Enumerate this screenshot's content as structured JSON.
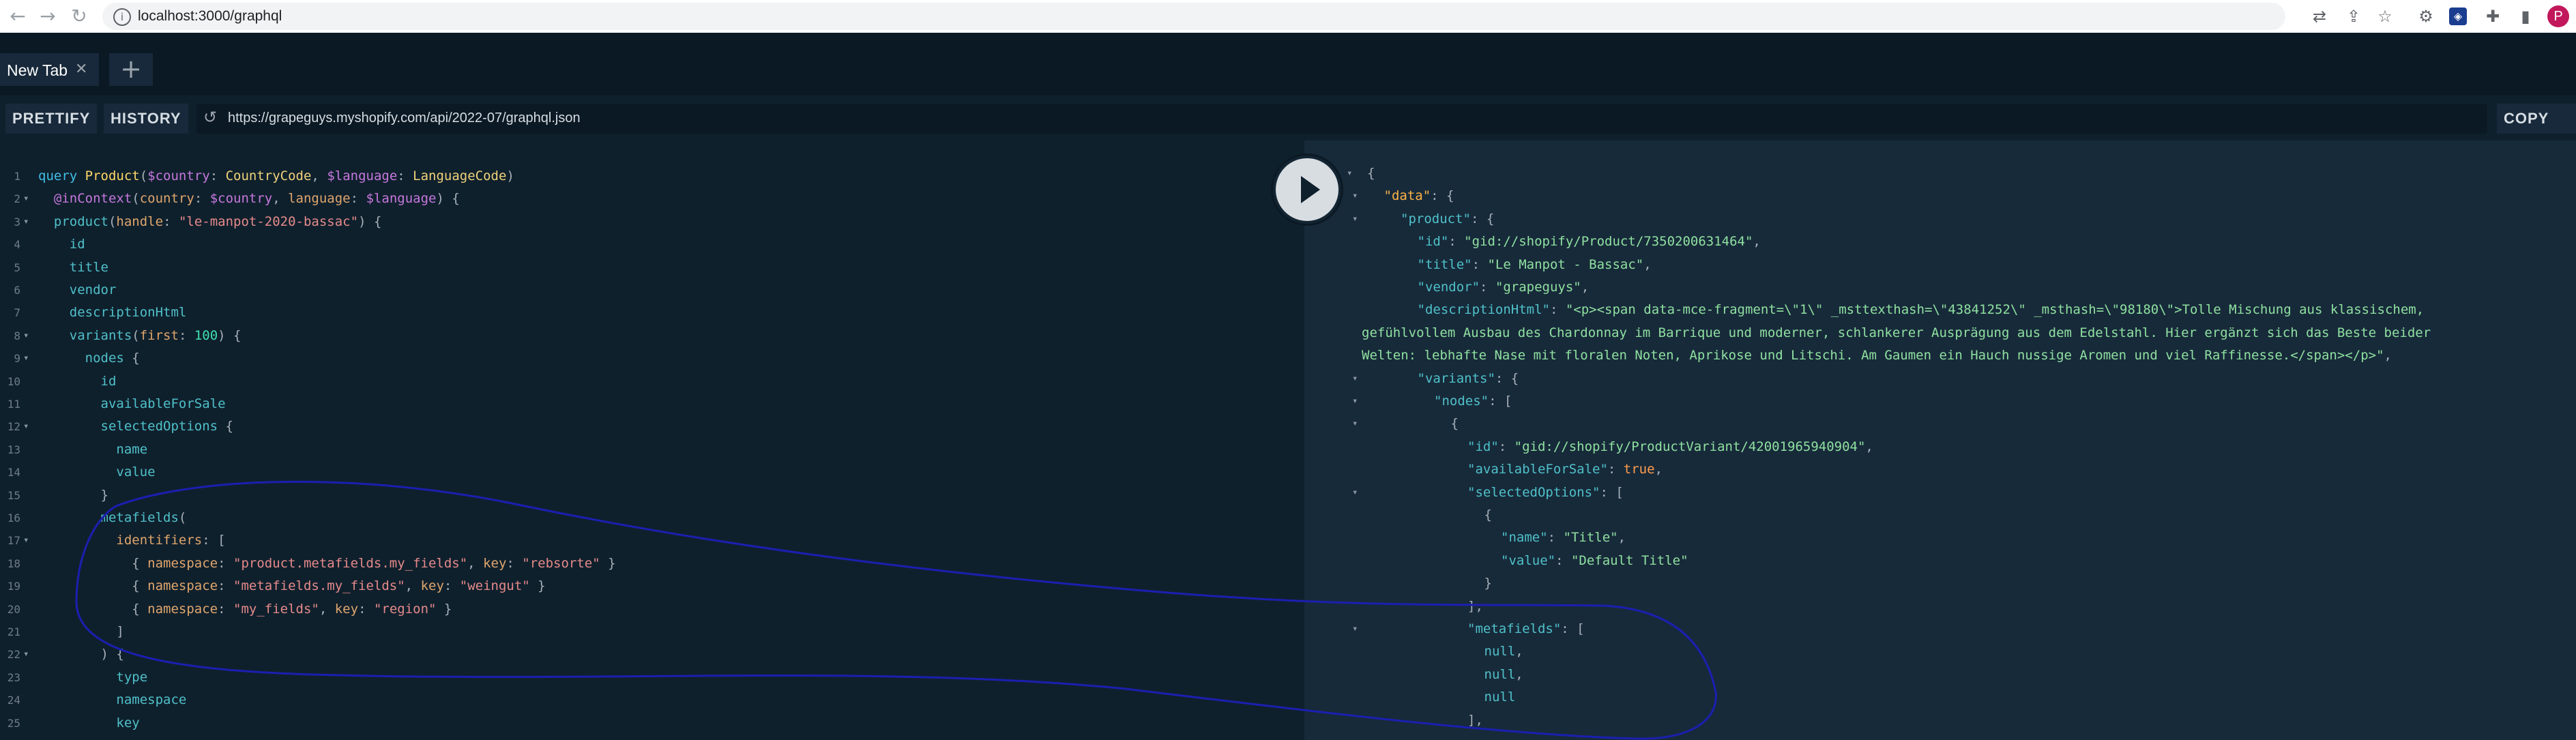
{
  "browser": {
    "url": "localhost:3000/graphql",
    "profile_initial": "P",
    "icons": [
      "translate-icon",
      "share-icon",
      "star-icon",
      "extension-gear-icon",
      "extension-logo-icon",
      "puzzle-icon",
      "sidebar-icon"
    ]
  },
  "tabs": [
    {
      "label": "New Tab"
    }
  ],
  "toolbar": {
    "prettify": "PRETTIFY",
    "history": "HISTORY",
    "endpoint": "https://grapeguys.myshopify.com/api/2022-07/graphql.json",
    "copy": "COPY CU"
  },
  "colors": {
    "background": "#0f202d",
    "result_background": "#172a3a",
    "keyword": "#3fbfe6",
    "string": "#e68a8a",
    "result_string": "#8fe0a0",
    "annotation_stroke": "#1b1fb0"
  },
  "query_lines": [
    {
      "n": "1",
      "fold": false,
      "segs": [
        [
          "kw",
          "query "
        ],
        [
          "fn",
          "Product"
        ],
        [
          "punct",
          "("
        ],
        [
          "var",
          "$country"
        ],
        [
          "punct",
          ": "
        ],
        [
          "type",
          "CountryCode"
        ],
        [
          "punct",
          ", "
        ],
        [
          "var",
          "$language"
        ],
        [
          "punct",
          ": "
        ],
        [
          "type",
          "LanguageCode"
        ],
        [
          "punct",
          ")"
        ]
      ]
    },
    {
      "n": "2",
      "fold": true,
      "segs": [
        [
          "punct",
          "  "
        ],
        [
          "dir",
          "@inContext"
        ],
        [
          "punct",
          "("
        ],
        [
          "arg",
          "country"
        ],
        [
          "punct",
          ": "
        ],
        [
          "var",
          "$country"
        ],
        [
          "punct",
          ", "
        ],
        [
          "arg",
          "language"
        ],
        [
          "punct",
          ": "
        ],
        [
          "var",
          "$language"
        ],
        [
          "punct",
          ") {"
        ]
      ]
    },
    {
      "n": "3",
      "fold": true,
      "segs": [
        [
          "punct",
          "  "
        ],
        [
          "field",
          "product"
        ],
        [
          "punct",
          "("
        ],
        [
          "arg",
          "handle"
        ],
        [
          "punct",
          ": "
        ],
        [
          "str",
          "\"le-manpot-2020-bassac\""
        ],
        [
          "punct",
          ") {"
        ]
      ]
    },
    {
      "n": "4",
      "fold": false,
      "segs": [
        [
          "field",
          "    id"
        ]
      ]
    },
    {
      "n": "5",
      "fold": false,
      "segs": [
        [
          "field",
          "    title"
        ]
      ]
    },
    {
      "n": "6",
      "fold": false,
      "segs": [
        [
          "field",
          "    vendor"
        ]
      ]
    },
    {
      "n": "7",
      "fold": false,
      "segs": [
        [
          "field",
          "    descriptionHtml"
        ]
      ]
    },
    {
      "n": "8",
      "fold": true,
      "segs": [
        [
          "field",
          "    variants"
        ],
        [
          "punct",
          "("
        ],
        [
          "arg",
          "first"
        ],
        [
          "punct",
          ": "
        ],
        [
          "num",
          "100"
        ],
        [
          "punct",
          ") {"
        ]
      ]
    },
    {
      "n": "9",
      "fold": true,
      "segs": [
        [
          "field",
          "      nodes"
        ],
        [
          "punct",
          " {"
        ]
      ]
    },
    {
      "n": "10",
      "fold": false,
      "segs": [
        [
          "field",
          "        id"
        ]
      ]
    },
    {
      "n": "11",
      "fold": false,
      "segs": [
        [
          "field",
          "        availableForSale"
        ]
      ]
    },
    {
      "n": "12",
      "fold": true,
      "segs": [
        [
          "field",
          "        selectedOptions"
        ],
        [
          "punct",
          " {"
        ]
      ]
    },
    {
      "n": "13",
      "fold": false,
      "segs": [
        [
          "field",
          "          name"
        ]
      ]
    },
    {
      "n": "14",
      "fold": false,
      "segs": [
        [
          "field",
          "          value"
        ]
      ]
    },
    {
      "n": "15",
      "fold": false,
      "segs": [
        [
          "punct",
          "        }"
        ]
      ]
    },
    {
      "n": "16",
      "fold": false,
      "segs": [
        [
          "field",
          "        metafields"
        ],
        [
          "punct",
          "("
        ]
      ]
    },
    {
      "n": "17",
      "fold": true,
      "segs": [
        [
          "arg",
          "          identifiers"
        ],
        [
          "punct",
          ": ["
        ]
      ]
    },
    {
      "n": "18",
      "fold": false,
      "segs": [
        [
          "punct",
          "            { "
        ],
        [
          "arg",
          "namespace"
        ],
        [
          "punct",
          ": "
        ],
        [
          "str",
          "\"product.metafields.my_fields\""
        ],
        [
          "punct",
          ", "
        ],
        [
          "arg",
          "key"
        ],
        [
          "punct",
          ": "
        ],
        [
          "str",
          "\"rebsorte\""
        ],
        [
          "punct",
          " }"
        ]
      ]
    },
    {
      "n": "19",
      "fold": false,
      "segs": [
        [
          "punct",
          "            { "
        ],
        [
          "arg",
          "namespace"
        ],
        [
          "punct",
          ": "
        ],
        [
          "str",
          "\"metafields.my_fields\""
        ],
        [
          "punct",
          ", "
        ],
        [
          "arg",
          "key"
        ],
        [
          "punct",
          ": "
        ],
        [
          "str",
          "\"weingut\""
        ],
        [
          "punct",
          " }"
        ]
      ]
    },
    {
      "n": "20",
      "fold": false,
      "segs": [
        [
          "punct",
          "            { "
        ],
        [
          "arg",
          "namespace"
        ],
        [
          "punct",
          ": "
        ],
        [
          "str",
          "\"my_fields\""
        ],
        [
          "punct",
          ", "
        ],
        [
          "arg",
          "key"
        ],
        [
          "punct",
          ": "
        ],
        [
          "str",
          "\"region\""
        ],
        [
          "punct",
          " }"
        ]
      ]
    },
    {
      "n": "21",
      "fold": false,
      "segs": [
        [
          "punct",
          "          ]"
        ]
      ]
    },
    {
      "n": "22",
      "fold": true,
      "segs": [
        [
          "punct",
          "        ) {"
        ]
      ]
    },
    {
      "n": "23",
      "fold": false,
      "segs": [
        [
          "field",
          "          type"
        ]
      ]
    },
    {
      "n": "24",
      "fold": false,
      "segs": [
        [
          "field",
          "          namespace"
        ]
      ]
    },
    {
      "n": "25",
      "fold": false,
      "segs": [
        [
          "field",
          "          key"
        ]
      ]
    }
  ],
  "result_lines": [
    {
      "fold": true,
      "indent": 0,
      "segs": [
        [
          "punct",
          "{"
        ]
      ]
    },
    {
      "fold": true,
      "indent": 1,
      "segs": [
        [
          "rdata",
          "\"data\""
        ],
        [
          "punct",
          ": {"
        ]
      ]
    },
    {
      "fold": true,
      "indent": 2,
      "segs": [
        [
          "rkey",
          "\"product\""
        ],
        [
          "punct",
          ": {"
        ]
      ]
    },
    {
      "fold": false,
      "indent": 3,
      "segs": [
        [
          "rkey",
          "\"id\""
        ],
        [
          "punct",
          ": "
        ],
        [
          "rstr",
          "\"gid://shopify/Product/7350200631464\""
        ],
        [
          "punct",
          ","
        ]
      ]
    },
    {
      "fold": false,
      "indent": 3,
      "segs": [
        [
          "rkey",
          "\"title\""
        ],
        [
          "punct",
          ": "
        ],
        [
          "rstr",
          "\"Le Manpot - Bassac\""
        ],
        [
          "punct",
          ","
        ]
      ]
    },
    {
      "fold": false,
      "indent": 3,
      "segs": [
        [
          "rkey",
          "\"vendor\""
        ],
        [
          "punct",
          ": "
        ],
        [
          "rstr",
          "\"grapeguys\""
        ],
        [
          "punct",
          ","
        ]
      ]
    },
    {
      "fold": false,
      "indent": 3,
      "segs": [
        [
          "rkey",
          "\"descriptionHtml\""
        ],
        [
          "punct",
          ": "
        ],
        [
          "rstr",
          "\"<p><span data-mce-fragment=\\\"1\\\" _msttexthash=\\\"43841252\\\" _msthash=\\\"98180\\\">Tolle Mischung aus klassischem,"
        ]
      ]
    },
    {
      "fold": false,
      "indent": -1,
      "segs": [
        [
          "rstr",
          "gefühlvollem Ausbau des Chardonnay im Barrique und moderner, schlankerer Ausprägung aus dem Edelstahl. Hier ergänzt sich das Beste beider"
        ]
      ]
    },
    {
      "fold": false,
      "indent": -1,
      "segs": [
        [
          "rstr",
          "Welten: lebhafte Nase mit floralen Noten, Aprikose und Litschi. Am Gaumen ein Hauch nussige Aromen und viel Raffinesse.</span></p>\""
        ],
        [
          "punct",
          ","
        ]
      ]
    },
    {
      "fold": true,
      "indent": 3,
      "segs": [
        [
          "rkey",
          "\"variants\""
        ],
        [
          "punct",
          ": {"
        ]
      ]
    },
    {
      "fold": true,
      "indent": 4,
      "segs": [
        [
          "rkey",
          "\"nodes\""
        ],
        [
          "punct",
          ": ["
        ]
      ]
    },
    {
      "fold": true,
      "indent": 5,
      "segs": [
        [
          "punct",
          "{"
        ]
      ]
    },
    {
      "fold": false,
      "indent": 6,
      "segs": [
        [
          "rkey",
          "\"id\""
        ],
        [
          "punct",
          ": "
        ],
        [
          "rstr",
          "\"gid://shopify/ProductVariant/42001965940904\""
        ],
        [
          "punct",
          ","
        ]
      ]
    },
    {
      "fold": false,
      "indent": 6,
      "segs": [
        [
          "rkey",
          "\"availableForSale\""
        ],
        [
          "punct",
          ": "
        ],
        [
          "rbool",
          "true"
        ],
        [
          "punct",
          ","
        ]
      ]
    },
    {
      "fold": true,
      "indent": 6,
      "segs": [
        [
          "rkey",
          "\"selectedOptions\""
        ],
        [
          "punct",
          ": ["
        ]
      ]
    },
    {
      "fold": false,
      "indent": 7,
      "segs": [
        [
          "punct",
          "{"
        ]
      ]
    },
    {
      "fold": false,
      "indent": 8,
      "segs": [
        [
          "rkey",
          "\"name\""
        ],
        [
          "punct",
          ": "
        ],
        [
          "rstr",
          "\"Title\""
        ],
        [
          "punct",
          ","
        ]
      ]
    },
    {
      "fold": false,
      "indent": 8,
      "segs": [
        [
          "rkey",
          "\"value\""
        ],
        [
          "punct",
          ": "
        ],
        [
          "rstr",
          "\"Default Title\""
        ]
      ]
    },
    {
      "fold": false,
      "indent": 7,
      "segs": [
        [
          "punct",
          "}"
        ]
      ]
    },
    {
      "fold": false,
      "indent": 6,
      "segs": [
        [
          "punct",
          "],"
        ]
      ]
    },
    {
      "fold": true,
      "indent": 6,
      "segs": [
        [
          "rkey",
          "\"metafields\""
        ],
        [
          "punct",
          ": ["
        ]
      ]
    },
    {
      "fold": false,
      "indent": 7,
      "segs": [
        [
          "rnull",
          "null"
        ],
        [
          "punct",
          ","
        ]
      ]
    },
    {
      "fold": false,
      "indent": 7,
      "segs": [
        [
          "rnull",
          "null"
        ],
        [
          "punct",
          ","
        ]
      ]
    },
    {
      "fold": false,
      "indent": 7,
      "segs": [
        [
          "rnull",
          "null"
        ]
      ]
    },
    {
      "fold": false,
      "indent": 6,
      "segs": [
        [
          "punct",
          "],"
        ]
      ]
    }
  ]
}
